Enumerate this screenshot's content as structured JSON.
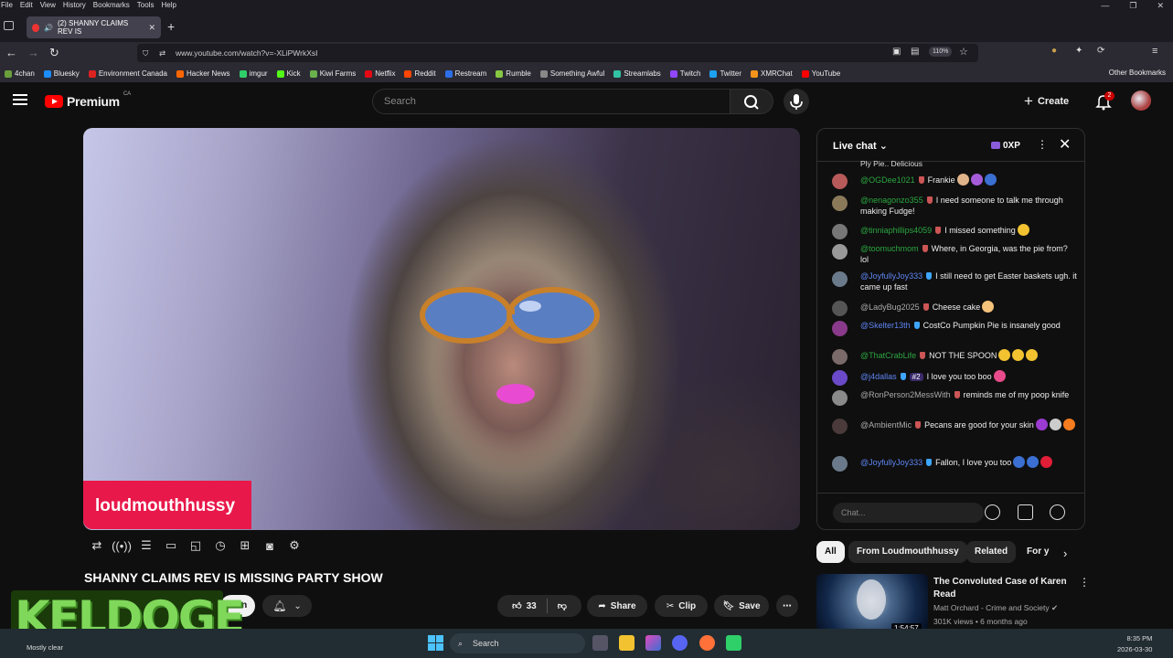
{
  "browser": {
    "menu": [
      "File",
      "Edit",
      "View",
      "History",
      "Bookmarks",
      "Tools",
      "Help"
    ],
    "tab_title": "(2) SHANNY CLAIMS REV IS",
    "url": "www.youtube.com/watch?v=-XLiPWrkXsI",
    "zoom": "110%",
    "bookmarks": [
      "4chan",
      "Bluesky",
      "Environment Canada",
      "Hacker News",
      "imgur",
      "Kick",
      "Kiwi Farms",
      "Netflix",
      "Reddit",
      "Restream",
      "Rumble",
      "Something Awful",
      "Streamlabs",
      "Twitch",
      "Twitter",
      "XMRChat",
      "YouTube"
    ],
    "bookmark_colors": [
      "#6a9f3b",
      "#1d8cff",
      "#d22",
      "#f60",
      "#2fd06a",
      "#53fc18",
      "#6ab04c",
      "#e50914",
      "#ff4500",
      "#2d6ee8",
      "#85c742",
      "#888",
      "#31c3a2",
      "#9146ff",
      "#1da1f2",
      "#f7931a",
      "#ff0000"
    ],
    "other_bookmarks": "Other Bookmarks"
  },
  "youtube": {
    "logo_text": "Premium",
    "country": "CA",
    "search_placeholder": "Search",
    "create_label": "Create",
    "notif_count": "2"
  },
  "video": {
    "name_tag": "loudmouthhussy",
    "title": "SHANNY CLAIMS REV IS MISSING PARTY SHOW",
    "join_label": "Join",
    "like_count": "33",
    "share_label": "Share",
    "clip_label": "Clip",
    "save_label": "Save",
    "overlay_text": "KELDOGE"
  },
  "chat": {
    "title": "Live chat",
    "xp": "0XP",
    "pinned_snippet": "Ply Pie.. Delicious",
    "input_placeholder": "Chat...",
    "messages": [
      {
        "author": "@OGDee1021",
        "text": "Frankie",
        "color": "green",
        "avatar": "#b85a5a",
        "emoji": [
          "#e0b48a",
          "#a65cd9",
          "#3b6fd1"
        ]
      },
      {
        "author": "@nenagonzo355",
        "text": "I need someone to talk me through making Fudge!",
        "color": "green",
        "avatar": "#8a7a5a",
        "emoji": []
      },
      {
        "author": "@tinniaphillips4059",
        "text": "I missed something",
        "color": "green",
        "avatar": "#777",
        "emoji": [
          "#f2c230"
        ]
      },
      {
        "author": "@toomuchmom",
        "text": "Where, in Georgia, was the pie from? lol",
        "color": "green",
        "avatar": "#999",
        "emoji": []
      },
      {
        "author": "@JoyfullyJoy333",
        "text": "I still need to get Easter baskets ugh. it came up fast",
        "color": "blue",
        "avatar": "#6a7a8a",
        "emoji": []
      },
      {
        "author": "@LadyBug2025",
        "text": "Cheese cake",
        "color": "gray",
        "avatar": "#555",
        "emoji": [
          "#f4c27a"
        ]
      },
      {
        "author": "@Skelter13th",
        "text": "CostCo Pumpkin Pie is insanely good",
        "color": "blue",
        "avatar": "#8a3a8a",
        "emoji": []
      },
      {
        "author": "@ThatCrabLife",
        "text": "NOT THE SPOON",
        "color": "green",
        "avatar": "#7a6a6a",
        "emoji": [
          "#f2c230",
          "#f2c230",
          "#f2c230"
        ]
      },
      {
        "author": "@j4dallas",
        "text": "I love you too boo",
        "color": "blue",
        "avatar": "#6a4ac9",
        "badge": "#2",
        "emoji": [
          "#e84b8a"
        ]
      },
      {
        "author": "@RonPerson2MessWith",
        "text": "reminds me of my poop knife",
        "color": "gray",
        "avatar": "#8a8a8a",
        "emoji": []
      },
      {
        "author": "@AmbientMic",
        "text": "Pecans are good for your skin",
        "color": "gray",
        "avatar": "#4a3a3a",
        "emoji": [
          "#9b3bd1",
          "#ccc",
          "#f57c1f"
        ]
      },
      {
        "author": "@JoyfullyJoy333",
        "text": "Fallon, I love you too",
        "color": "blue",
        "avatar": "#6a7a8a",
        "emoji": [
          "#3b6fd1",
          "#3b6fd1",
          "#e01e37"
        ]
      }
    ]
  },
  "chips": [
    "All",
    "From Loudmouthhussy",
    "Related",
    "For y"
  ],
  "recommended": {
    "title": "The Convoluted Case of Karen Read",
    "channel": "Matt Orchard - Crime and Society",
    "meta": "301K views • 6 months ago",
    "duration": "1:54:57"
  },
  "taskbar": {
    "weather": "Mostly clear",
    "search": "Search",
    "time": "8:35 PM",
    "date": "2026-03-30"
  }
}
